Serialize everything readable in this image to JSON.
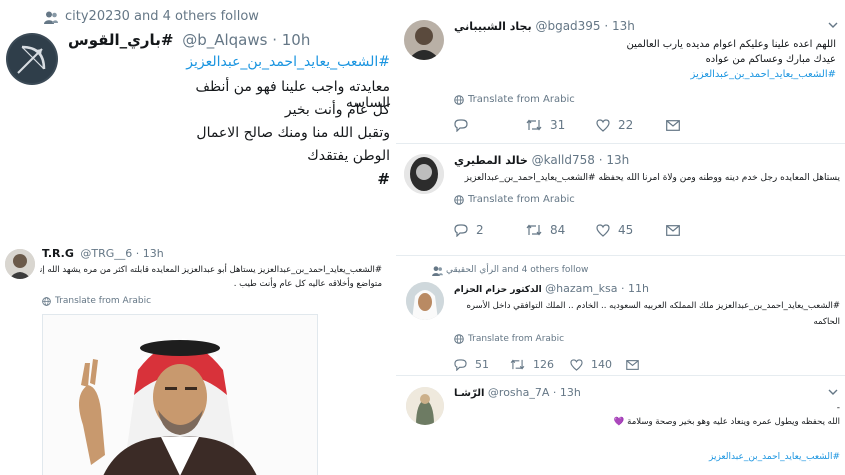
{
  "left_top": {
    "social_context": "city20230 and 4 others follow",
    "name": "باري_القوس#",
    "handle": "@b_Alqaws",
    "time": "10h",
    "hashtag": "#الشعب_يعايد_احمد_بن_عبدالعزيز",
    "lines": [
      "معايدته واجب علينا فهو من أنظف الساسه",
      "كل عام وأنت بخير",
      "وتقبل الله منا ومنك صالح الاعمال",
      "الوطن يفتقدك",
      "#"
    ]
  },
  "left_bottom": {
    "name": "T.R.G",
    "handle": "@TRG__6",
    "time": "13h",
    "text_line1": "#الشعب_يعايد_احمد_بن_عبدالعزيز يستاهل أبو عبدالعزيز المعايده قابلته اكثر من مره يشهد الله إنه رجل",
    "text_line2": "متواضع وأخلاقه عاليه كل عام وأنت طيب .",
    "translate": "Translate from Arabic"
  },
  "right": {
    "t1": {
      "name": "بجاد الشبيباني",
      "handle": "@bgad395",
      "time": "13h",
      "line1": "اللهم اعده علينا وعليكم اعوام مديده يارب العالمين",
      "line2": "عيدك مبارك وعساكم من عواده",
      "hashtag": "#الشعب_يعايد_احمد_بن_عبدالعزيز",
      "translate": "Translate from Arabic",
      "retweets": "31",
      "likes": "22"
    },
    "t2": {
      "name": "خالد المطيري",
      "handle": "@kalld758",
      "time": "13h",
      "text": "يستاهل المعايده رجل خدم دينه ووطنه ومن ولاة امرنا الله يحفظه #الشعب_يعايد_احمد_بن_عبدالعزيز",
      "translate": "Translate from Arabic",
      "replies": "2",
      "retweets": "84",
      "likes": "45"
    },
    "t3": {
      "social_context": "الرأي الحقيقي and 4 others follow",
      "name": "الدكتور حزام الحزام",
      "handle": "@hazam_ksa",
      "time": "11h",
      "line1": "#الشعب_يعايد_احمد_بن_عبدالعزيز ملك المملكه العربيه السعوديه .. الخادم .. الملك التوافقي داخل الأسره",
      "line2": "الحاكمه",
      "translate": "Translate from Arabic",
      "replies": "51",
      "retweets": "126",
      "likes": "140"
    },
    "t4": {
      "name": "الرّشـا",
      "handle": "@rosha_7A",
      "time": "13h",
      "line0": "-",
      "line1": "الله يحفظه ويطول عمره وينعاد عليه وهو بخير وصحة وسلامة 💜",
      "hashtag": "#الشعب_يعايد_احمد_بن_عبدالعزيز"
    }
  },
  "colors": {
    "link": "#1b95e0",
    "muted": "#657786",
    "heart_purple": "#a35cd6"
  }
}
